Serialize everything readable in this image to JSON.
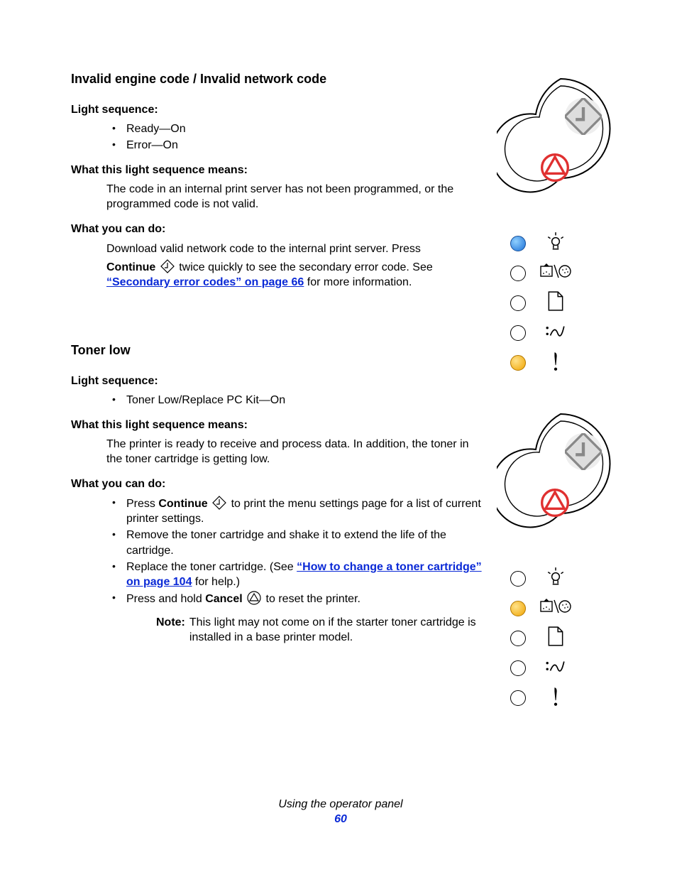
{
  "footer": {
    "title": "Using the operator panel",
    "page": "60"
  },
  "section1": {
    "title": "Invalid engine code / Invalid network code",
    "lightSeqHeading": "Light sequence:",
    "lights": [
      "Ready—On",
      "Error—On"
    ],
    "meansHeading": "What this light sequence means:",
    "meansBody": "The code in an internal print server has not been programmed, or the programmed code is not valid.",
    "doHeading": "What you can do:",
    "doLine1": "Download valid network code to the internal print server. Press",
    "doLine2_pre": "Continue",
    "doLine2_mid": " twice quickly to see the secondary error code. See ",
    "doLine2_link": "“Secondary error codes” on page 66",
    "doLine2_post": " for more information."
  },
  "section2": {
    "title": "Toner low",
    "lightSeqHeading": "Light sequence:",
    "lights": [
      "Toner Low/Replace PC Kit—On"
    ],
    "meansHeading": "What this light sequence means:",
    "meansBody": "The printer is ready to receive and process data. In addition, the toner in the toner cartridge is getting low.",
    "doHeading": "What you can do:",
    "bullets": {
      "b1_pre": "Press ",
      "b1_bold": "Continue",
      "b1_post": " to print the menu settings page for a list of current printer settings.",
      "b2": "Remove the toner cartridge and shake it to extend the life of the cartridge.",
      "b3_pre": "Replace the toner cartridge. (See ",
      "b3_link": "“How to change a toner cartridge” on page 104",
      "b3_post": " for help.)",
      "b4_pre": "Press and hold ",
      "b4_bold": "Cancel",
      "b4_post": " to reset the printer."
    },
    "noteLabel": "Note:",
    "noteText": "This light may not come on if the starter toner cartridge is installed in a base printer model."
  },
  "panelA": {
    "lights": [
      {
        "state": "blue",
        "icon": "ready"
      },
      {
        "state": "off",
        "icon": "toner"
      },
      {
        "state": "off",
        "icon": "paper"
      },
      {
        "state": "off",
        "icon": "jam"
      },
      {
        "state": "orange",
        "icon": "error"
      }
    ]
  },
  "panelB": {
    "lights": [
      {
        "state": "off",
        "icon": "ready"
      },
      {
        "state": "orange",
        "icon": "toner"
      },
      {
        "state": "off",
        "icon": "paper"
      },
      {
        "state": "off",
        "icon": "jam"
      },
      {
        "state": "off",
        "icon": "error"
      }
    ]
  }
}
